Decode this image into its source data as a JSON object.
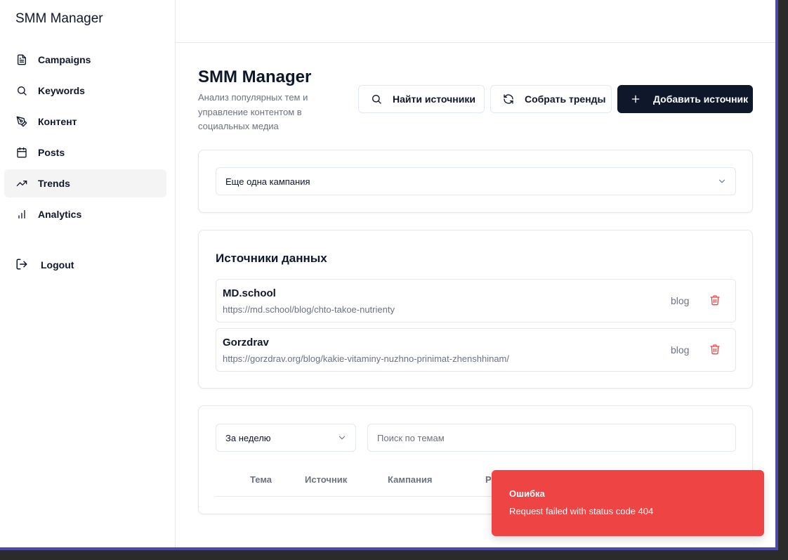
{
  "app": {
    "brand": "SMM Manager"
  },
  "sidebar": {
    "items": [
      {
        "label": "Campaigns",
        "icon": "file-text-icon",
        "active": false
      },
      {
        "label": "Keywords",
        "icon": "search-icon",
        "active": false
      },
      {
        "label": "Контент",
        "icon": "pen-tool-icon",
        "active": false
      },
      {
        "label": "Posts",
        "icon": "calendar-icon",
        "active": false
      },
      {
        "label": "Trends",
        "icon": "trending-up-icon",
        "active": true
      },
      {
        "label": "Analytics",
        "icon": "bar-chart-icon",
        "active": false
      }
    ],
    "logout": "Logout"
  },
  "header": {
    "title": "SMM Manager",
    "subtitle": "Анализ популярных тем и управление контентом в социальных медиа",
    "buttons": {
      "find": "Найти источники",
      "collect": "Собрать тренды",
      "add": "Добавить источник"
    }
  },
  "campaign_select": {
    "value": "Еще одна кампания"
  },
  "sources": {
    "title": "Источники данных",
    "items": [
      {
        "name": "MD.school",
        "url": "https://md.school/blog/chto-takoe-nutrienty",
        "type": "blog"
      },
      {
        "name": "Gorzdrav",
        "url": "https://gorzdrav.org/blog/kakie-vitaminy-nuzhno-prinimat-zhenshhinam/",
        "type": "blog"
      }
    ]
  },
  "trends": {
    "period": "За неделю",
    "search_placeholder": "Поиск по темам",
    "columns": [
      "Тема",
      "Источник",
      "Кампания",
      "Ре"
    ]
  },
  "toast": {
    "title": "Ошибка",
    "message": "Request failed with status code 404"
  },
  "colors": {
    "primary": "#0f172a",
    "destructive": "#ef4444",
    "muted_text": "#6b7280",
    "border": "#e5e7eb",
    "active_nav": "#f4f4f5",
    "frame": "#4b4aa8"
  }
}
